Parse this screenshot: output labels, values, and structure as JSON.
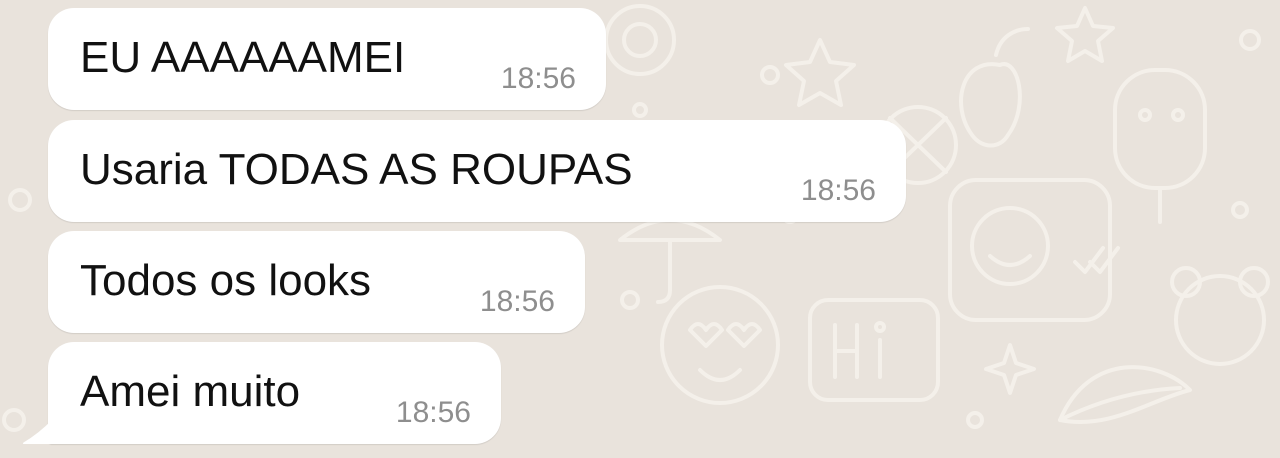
{
  "colors": {
    "chat_background": "#e9e3dc",
    "bubble_incoming": "#ffffff",
    "message_text": "#111111",
    "timestamp_text": "#8e8e8e"
  },
  "messages": [
    {
      "text": "EU AAAAAAMEI",
      "time": "18:56"
    },
    {
      "text": "Usaria TODAS AS ROUPAS",
      "time": "18:56"
    },
    {
      "text": "Todos os looks",
      "time": "18:56"
    },
    {
      "text": "Amei muito",
      "time": "18:56"
    }
  ]
}
